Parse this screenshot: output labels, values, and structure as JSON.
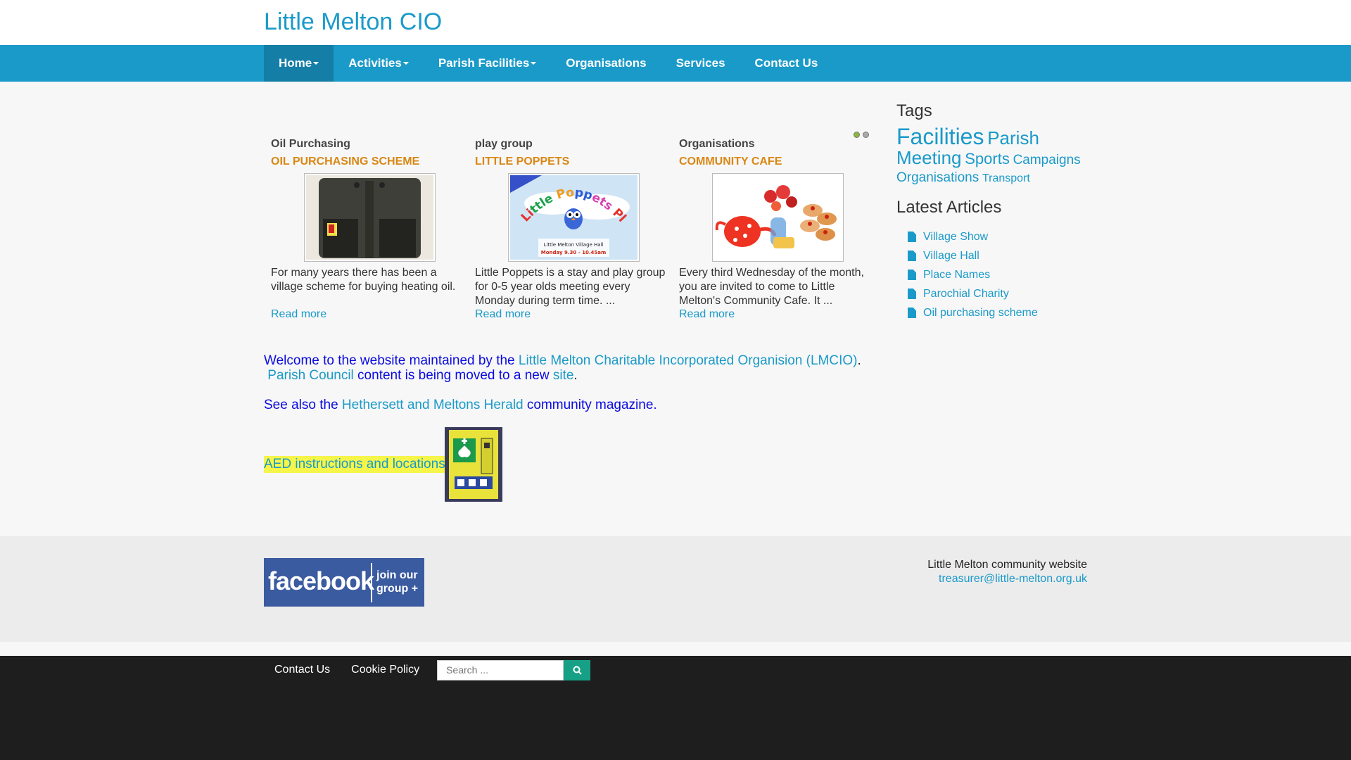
{
  "site": {
    "title": "Little Melton CIO"
  },
  "nav": {
    "items": [
      {
        "label": "Home",
        "dropdown": true,
        "active": true
      },
      {
        "label": "Activities",
        "dropdown": true
      },
      {
        "label": "Parish Facilities",
        "dropdown": true
      },
      {
        "label": "Organisations",
        "dropdown": false
      },
      {
        "label": "Services",
        "dropdown": false
      },
      {
        "label": "Contact Us",
        "dropdown": false
      }
    ]
  },
  "carousel": {
    "items": [
      {
        "category": "Oil Purchasing",
        "title": "OIL PURCHASING SCHEME",
        "image": "oil-tank-image",
        "description": "For many years there has been a village scheme for buying heating oil.",
        "read_more": "Read more"
      },
      {
        "category": "play group",
        "title": "LITTLE POPPETS",
        "image": "little-poppets-playgroup-poster",
        "image_caption_1": "Little Poppets Playgroup",
        "image_caption_2": "Little Melton Village Hall",
        "image_caption_3": "Monday 9.30 - 10.45am",
        "description": "Little Poppets is a stay and play group for 0-5 year olds meeting every Monday during term time. ...",
        "read_more": "Read more"
      },
      {
        "category": "Organisations",
        "title": "COMMUNITY CAFE",
        "image": "tea-and-cakes-image",
        "description": "Every third Wednesday of the month, you are invited to come to Little Melton's Community Cafe. It ...",
        "read_more": "Read more"
      }
    ],
    "active_dot": 0,
    "dot_count": 2
  },
  "welcome": {
    "pre": "Welcome to the website maintained by the ",
    "link1": "Little Melton Charitable Incorporated Organision (LMCIO)",
    "dot1": ".",
    "link2": "Parish Council",
    "mid": " content is being moved to a new ",
    "link3": "site",
    "dot2": "."
  },
  "seealso": {
    "pre": "See also the ",
    "link": "Hethersett and Meltons Herald",
    "post": " community magazine."
  },
  "aed": {
    "label": "AED instructions and locations",
    "image": "aed-defibrillator-cabinet"
  },
  "sidebar": {
    "tags_heading": "Tags",
    "tags": [
      {
        "label": "Facilities",
        "size": "t1"
      },
      {
        "label": "Parish Meeting",
        "size": "t2"
      },
      {
        "label": "Sports",
        "size": "t3"
      },
      {
        "label": "Campaigns",
        "size": "t4"
      },
      {
        "label": "Organisations",
        "size": "t4"
      },
      {
        "label": "Transport",
        "size": "t5"
      }
    ],
    "latest_heading": "Latest Articles",
    "articles": [
      "Village Show",
      "Village Hall",
      "Place Names",
      "Parochial Charity",
      "Oil purchasing scheme"
    ]
  },
  "footer": {
    "facebook_word": "facebook",
    "facebook_join_1": "join our",
    "facebook_join_2": "group +",
    "site_text": "Little Melton community website",
    "email": "treasurer@little-melton.org.uk"
  },
  "bottom": {
    "links": [
      "Contact Us",
      "Cookie Policy"
    ],
    "search_placeholder": "Search ...",
    "search_icon": "search-icon"
  },
  "colors": {
    "brand": "#1a9ac9",
    "nav_active": "#147ea6",
    "title_orange": "#d98714",
    "search_button": "#16a085"
  }
}
